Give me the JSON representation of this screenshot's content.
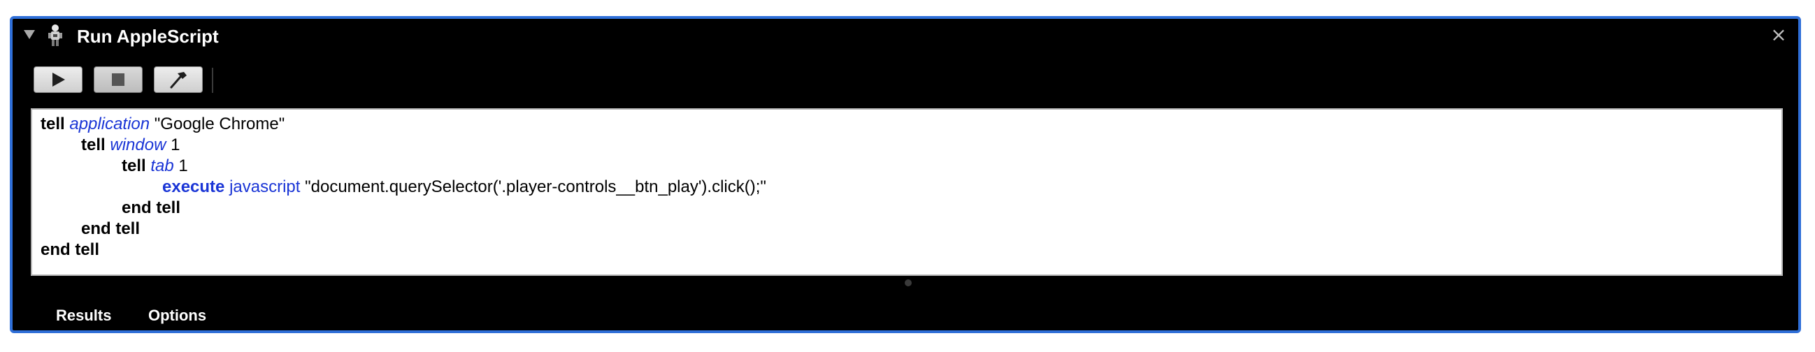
{
  "action": {
    "title": "Run AppleScript",
    "icon": "automator-robot-icon",
    "close_glyph": "×",
    "disclosure_state": "expanded"
  },
  "toolbar": {
    "buttons": [
      {
        "name": "run",
        "icon": "play-icon"
      },
      {
        "name": "stop",
        "icon": "stop-icon"
      },
      {
        "name": "compile",
        "icon": "hammer-icon"
      }
    ]
  },
  "script": {
    "line1": {
      "kw": "tell",
      "cls": "application",
      "str": "\"Google Chrome\""
    },
    "line2": {
      "kw": "tell",
      "cls": "window",
      "num": "1"
    },
    "line3": {
      "kw": "tell",
      "cls": "tab",
      "num": "1"
    },
    "line4": {
      "cmd": "execute",
      "param": "javascript",
      "str": "\"document.querySelector('.player-controls__btn_play').click();\""
    },
    "line5": {
      "kw": "end tell"
    },
    "line6": {
      "kw": "end tell"
    },
    "line7": {
      "kw": "end tell"
    }
  },
  "tabs": {
    "results": "Results",
    "options": "Options"
  },
  "colors": {
    "panel_background": "#000000",
    "panel_border": "#2f6fd8",
    "keyword_blue": "#1a35d6"
  }
}
